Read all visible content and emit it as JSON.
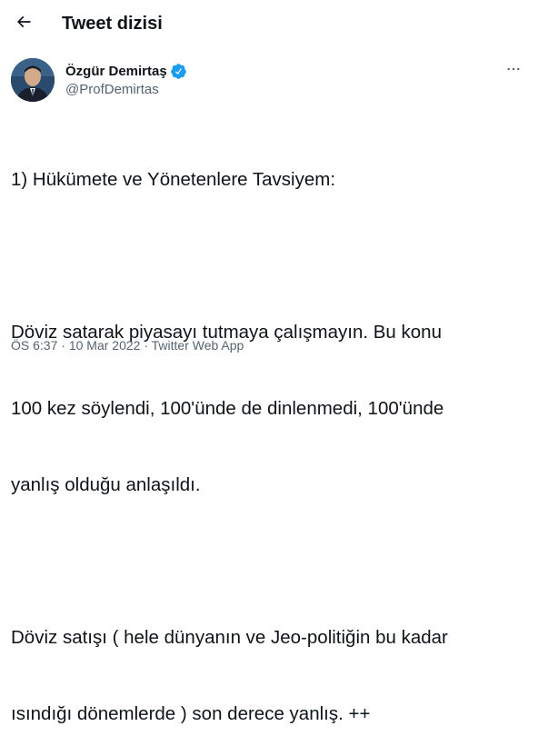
{
  "header": {
    "back_icon": "arrow-left-icon",
    "title": "Tweet dizisi"
  },
  "author": {
    "name": "Özgür Demirtaş",
    "handle": "@ProfDemirtas",
    "verified": true,
    "verified_icon": "verified-badge-icon",
    "more_icon": "more-horizontal-icon"
  },
  "tweet": {
    "lines": [
      "1) Hükümete ve Yönetenlere Tavsiyem:",
      "",
      "Döviz satarak piyasayı tutmaya çalışmayın. Bu konu",
      "100 kez söylendi, 100'ünde de dinlenmedi, 100'ünde",
      "yanlış olduğu anlaşıldı.",
      "",
      "Döviz satışı ( hele dünyanın ve Jeo-politiğin bu kadar",
      "ısındığı dönemlerde ) son derece yanlış. ++"
    ]
  },
  "meta": {
    "time": "ÖS 6:37",
    "separator1": " · ",
    "date": "10 Mar 2022",
    "separator2": " · ",
    "source": "Twitter Web App"
  },
  "colors": {
    "text": "#0f1419",
    "secondary": "#536471",
    "verified": "#1d9bf0",
    "background": "#ffffff"
  }
}
